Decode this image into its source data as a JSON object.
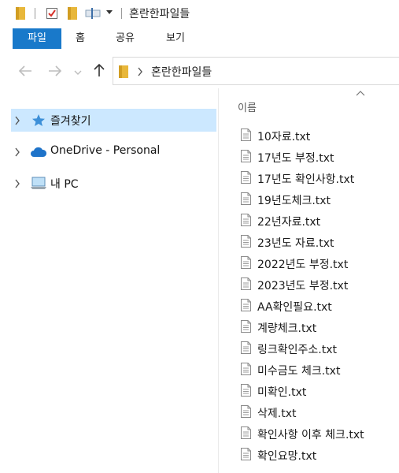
{
  "window": {
    "title": "혼란한파일들"
  },
  "quick_access": {
    "dropdown_icon": "chevron-down-icon"
  },
  "ribbon": {
    "tabs": [
      {
        "label": "파일",
        "active": true
      },
      {
        "label": "홈"
      },
      {
        "label": "공유"
      },
      {
        "label": "보기"
      }
    ],
    "accent": "#1979ca"
  },
  "address_bar": {
    "path": "혼란한파일들"
  },
  "nav_pane": {
    "items": [
      {
        "label": "즐겨찾기",
        "icon": "star-icon",
        "selected": true
      },
      {
        "label": "OneDrive - Personal",
        "icon": "cloud-icon"
      },
      {
        "label": "내 PC",
        "icon": "computer-icon"
      }
    ],
    "selection_color": "#cce8ff"
  },
  "file_list": {
    "column_header": "이름",
    "files": [
      "10자료.txt",
      "17년도 부정.txt",
      "17년도 확인사항.txt",
      "19년도체크.txt",
      "22년자료.txt",
      "23년도 자료.txt",
      "2022년도 부정.txt",
      "2023년도 부정.txt",
      "AA확인필요.txt",
      "계량체크.txt",
      "링크확인주소.txt",
      "미수금도 체크.txt",
      "미확인.txt",
      "삭제.txt",
      "확인사항 이후 체크.txt",
      "확인요망.txt"
    ]
  }
}
